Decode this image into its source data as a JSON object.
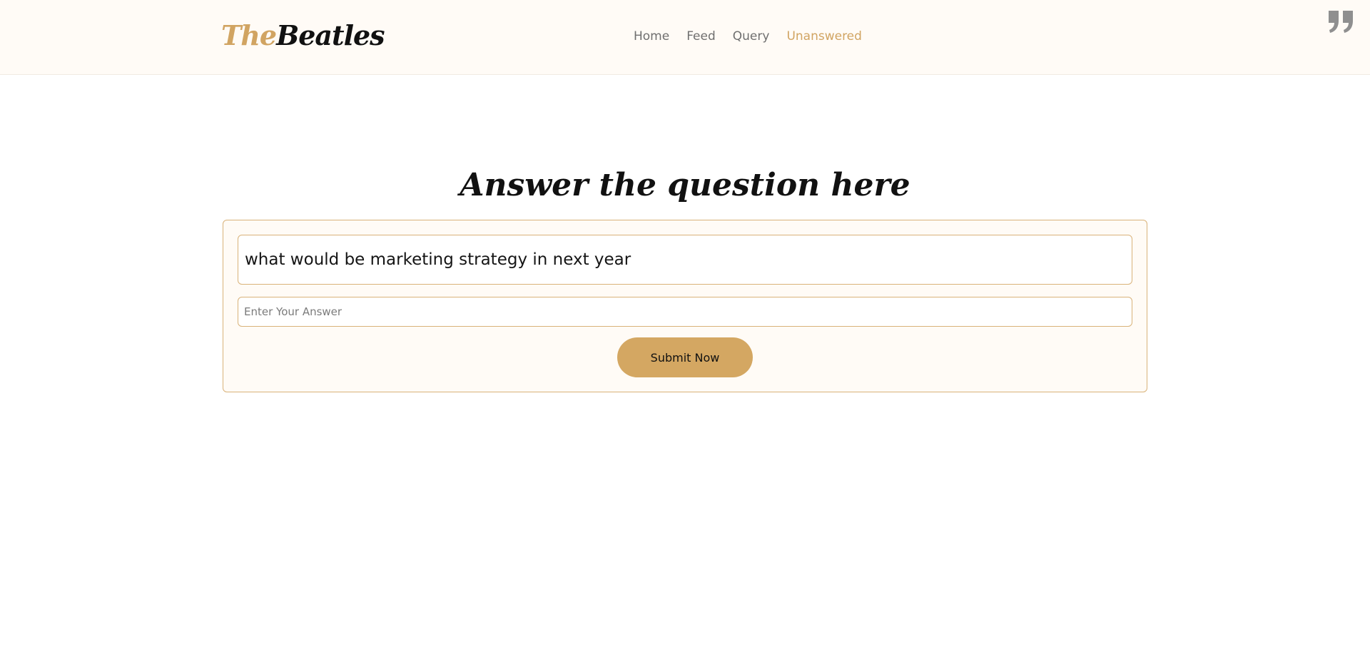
{
  "header": {
    "brand_prefix": "The",
    "brand_name": "Beatles",
    "nav": [
      {
        "label": "Home",
        "active": false
      },
      {
        "label": "Feed",
        "active": false
      },
      {
        "label": "Query",
        "active": false
      },
      {
        "label": "Unanswered",
        "active": true
      }
    ],
    "icon": "quote-icon"
  },
  "main": {
    "heading": "Answer the question here",
    "question": "what would be marketing strategy in next year",
    "answer_value": "",
    "answer_placeholder": "Enter Your Answer",
    "submit_label": "Submit Now"
  },
  "colors": {
    "accent": "#d4a762",
    "header_bg": "#fffbf6",
    "nav_text": "#6f6f6f",
    "border": "#d9b279"
  }
}
